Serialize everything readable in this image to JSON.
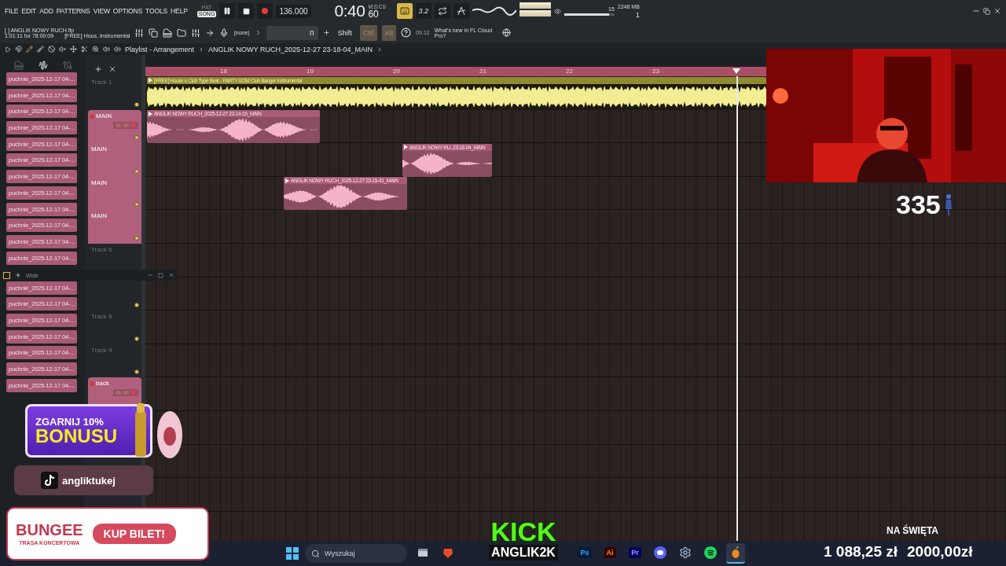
{
  "menu": [
    "FILE",
    "EDIT",
    "ADD",
    "PATTERNS",
    "VIEW",
    "OPTIONS",
    "TOOLS",
    "HELP"
  ],
  "transport": {
    "modes": [
      {
        "label": "PAT",
        "selected": false
      },
      {
        "label": "SONG",
        "selected": true
      }
    ],
    "tempo": "136.000",
    "time": "0:40",
    "time_cs": "60",
    "time_unit": "M:S:CS",
    "tools": [
      {
        "kind": "typing",
        "on": true
      },
      {
        "kind": "text",
        "label": "3.2",
        "on": false
      },
      {
        "kind": "loop",
        "on": false
      },
      {
        "kind": "metronome",
        "on": false
      }
    ]
  },
  "monitor": {
    "cpu": "15",
    "memory": "2248 MB",
    "voices": "1",
    "volume": {
      "level": 0.9
    }
  },
  "project": {
    "file": "[ ] ANGLIK NOWY RUCH.flp",
    "position": "1:01:11 for 78:00:09",
    "hint": "[FREE] Hous..Instrumental"
  },
  "snap": "(none)",
  "pattern_field": "n",
  "modifiers": [
    {
      "label": "Shift",
      "on": false
    },
    {
      "label": "Ctrl",
      "on": true
    },
    {
      "label": "Alt",
      "on": true
    }
  ],
  "news": {
    "date": "09.12",
    "text": "What's new in FL Cloud Pro?"
  },
  "browser": {
    "tabs": [
      {
        "kind": "piano",
        "selected": false
      },
      {
        "kind": "audio",
        "selected": true
      },
      {
        "kind": "cable",
        "selected": false
      }
    ],
    "items": [
      "puchnie_2025-12-17 04-...",
      "puchnie_2025-12-17 04-...",
      "puchnie_2025-12-17 04-...",
      "puchnie_2025-12-17 04-...",
      "puchnie_2025-12-17 04-...",
      "puchnie_2025-12-17 04-...",
      "puchnie_2025-12-17 04-...",
      "puchnie_2025-12-17 04-...",
      "puchnie_2025-12-17 04-...",
      "puchnie_2025-12-17 04-...",
      "puchnie_2025-12-17 04-...",
      "puchnie_2025-12-17 04-...",
      "puchnie_2025-12-17 04-...",
      "puchnie_2025-12-17 04-...",
      "puchnie_2025-12-17 04-...",
      "puchnie_2025-12-17 04-...",
      "puchnie_2025-12-17 04-...",
      "puchnie_2025-12-17 04-...",
      "puchnie_2025-12-17 04-..."
    ]
  },
  "floating_window": {
    "title": "Wide"
  },
  "playlist": {
    "title": "Playlist - Arrangement",
    "pattern": "ANGLIK NOWY RUCH_2025-12-27 23-18-04_MAIN",
    "bars": [
      "18",
      "19",
      "20",
      "21",
      "22",
      "23"
    ],
    "tracks": [
      {
        "kind": "plain",
        "name": "Track 1",
        "clips": [
          {
            "kind": "beat",
            "title": "[FREE] House x Club Type Beat - PARTY  EDM Club Banger Instrumental"
          }
        ]
      },
      {
        "kind": "group",
        "name": "MAIN",
        "clips": [
          {
            "kind": "vocal",
            "title": "ANGLIK NOWY RUCH_2025-12-27 23-14-19_MAIN"
          }
        ]
      },
      {
        "kind": "group",
        "name": "MAIN",
        "clips": [
          {
            "kind": "vocal",
            "title": "ANGLIK NOWY RU..23-18-04_MAIN"
          }
        ]
      },
      {
        "kind": "group",
        "name": "MAIN",
        "clips": [
          {
            "kind": "vocal",
            "title": "ANGLIK NOWY RUCH_2025-12-27 23-15-41_MAIN"
          }
        ]
      },
      {
        "kind": "group",
        "name": "MAIN"
      },
      {
        "kind": "plain",
        "name": "Track 6"
      },
      {
        "kind": "plain"
      },
      {
        "kind": "plain",
        "name": "Track 8"
      },
      {
        "kind": "plain",
        "name": "Track 9"
      },
      {
        "kind": "group",
        "name": "back"
      }
    ]
  },
  "webcam": {
    "kind": "picture"
  },
  "overlays": {
    "viewer_count": "335",
    "bonus": {
      "line1": "ZGARNIJ 10%",
      "line2": "BONUSU"
    },
    "tiktok": "angliktukej",
    "bungee": {
      "brand": "BUNGEE",
      "subtitle": "TRASA KONCERTOWA",
      "button": "KUP BILET!"
    },
    "kick": {
      "brand": "KICK",
      "user": "ANGLIK2K"
    },
    "goal": {
      "title": "NA ŚWIĘTA",
      "current": "1 088,25 zł",
      "target": "2000,00zł"
    }
  },
  "taskbar": {
    "search": {
      "placeholder": "Wyszukaj"
    },
    "apps": [
      {
        "kind": "files",
        "selected": false
      },
      {
        "kind": "brave",
        "selected": false
      },
      {
        "kind": "ps",
        "label": "Ps",
        "selected": false
      },
      {
        "kind": "ai",
        "label": "Ai",
        "selected": false
      },
      {
        "kind": "pr",
        "label": "Pr",
        "selected": false
      },
      {
        "kind": "discord",
        "selected": false
      },
      {
        "kind": "settings",
        "selected": false
      },
      {
        "kind": "spotify",
        "selected": false
      },
      {
        "kind": "fl",
        "selected": true
      }
    ]
  }
}
